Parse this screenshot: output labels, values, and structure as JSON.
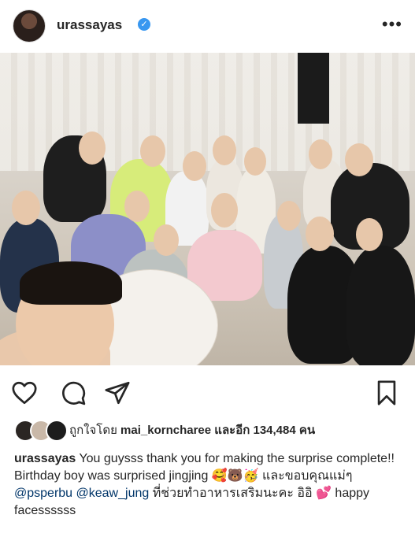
{
  "post": {
    "username": "urassayas",
    "verified_mark": "✓",
    "more_label": "•••",
    "photo_alt": ""
  },
  "actions": {
    "like_icon": "heart-icon",
    "comment_icon": "comment-icon",
    "share_icon": "share-icon",
    "save_icon": "bookmark-icon"
  },
  "likes": {
    "prefix": "ถูกใจโดย",
    "liker": "mai_korncharee",
    "suffix": "และอีก 134,484 คน"
  },
  "caption": {
    "username": "urassayas",
    "text_1": "You guysss thank you for making the surprise complete!! Birthday boy was surprised jingjing 🥰🐻🥳 และขอบคุณแม่ๆ",
    "mention_1": "@psperbu",
    "mention_2": "@keaw_jung",
    "text_2": "ที่ช่วยทำอาหารเสริมนะคะ อิอิ 💕 happy facessssss"
  }
}
